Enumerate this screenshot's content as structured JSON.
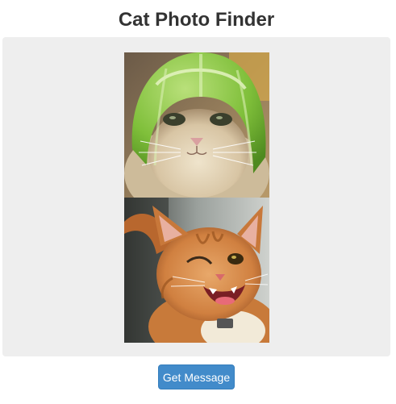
{
  "page": {
    "title": "Cat Photo Finder"
  },
  "message": {
    "photos": [
      {
        "subject": "cat wearing lime peel helmet"
      },
      {
        "subject": "winking orange tabby cat"
      }
    ]
  },
  "actions": {
    "get_message_label": "Get Message"
  },
  "colors": {
    "title_text": "#333333",
    "message_bg": "#eeeeee",
    "button_bg": "#428bca",
    "button_border": "#357ebd",
    "button_text": "#ffffff"
  }
}
